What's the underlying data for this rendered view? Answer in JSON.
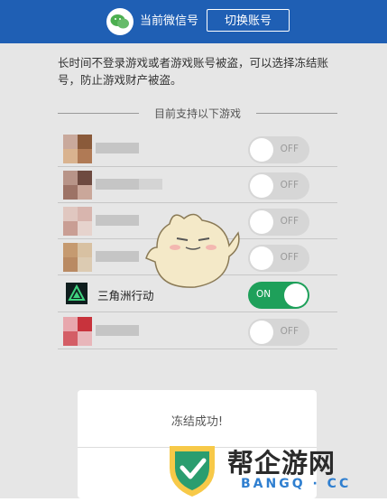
{
  "header": {
    "title": "当前微信号",
    "switch_label": "切换账号",
    "avatar_icon": "wechat-icon",
    "bg_color": "#1f5fb4"
  },
  "intro_text": "长时间不登录游戏或者游戏账号被盗，可以选择冻结账号，防止游戏财产被盗。",
  "section_title": "目前支持以下游戏",
  "games": [
    {
      "name": "",
      "toggle_label": "OFF",
      "enabled": false
    },
    {
      "name": "",
      "toggle_label": "OFF",
      "enabled": false
    },
    {
      "name": "",
      "toggle_label": "OFF",
      "enabled": false
    },
    {
      "name": "",
      "toggle_label": "OFF",
      "enabled": false
    },
    {
      "name": "三角洲行动",
      "toggle_label": "ON",
      "enabled": true
    },
    {
      "name": "",
      "toggle_label": "OFF",
      "enabled": false
    }
  ],
  "dialog": {
    "message": "冻结成功!"
  },
  "watermark": {
    "text": "帮企游网",
    "sub": "BANGQ · CC"
  },
  "colors": {
    "on": "#1ea05a",
    "off": "#d6d6d6",
    "accent": "#1f5fb4"
  }
}
